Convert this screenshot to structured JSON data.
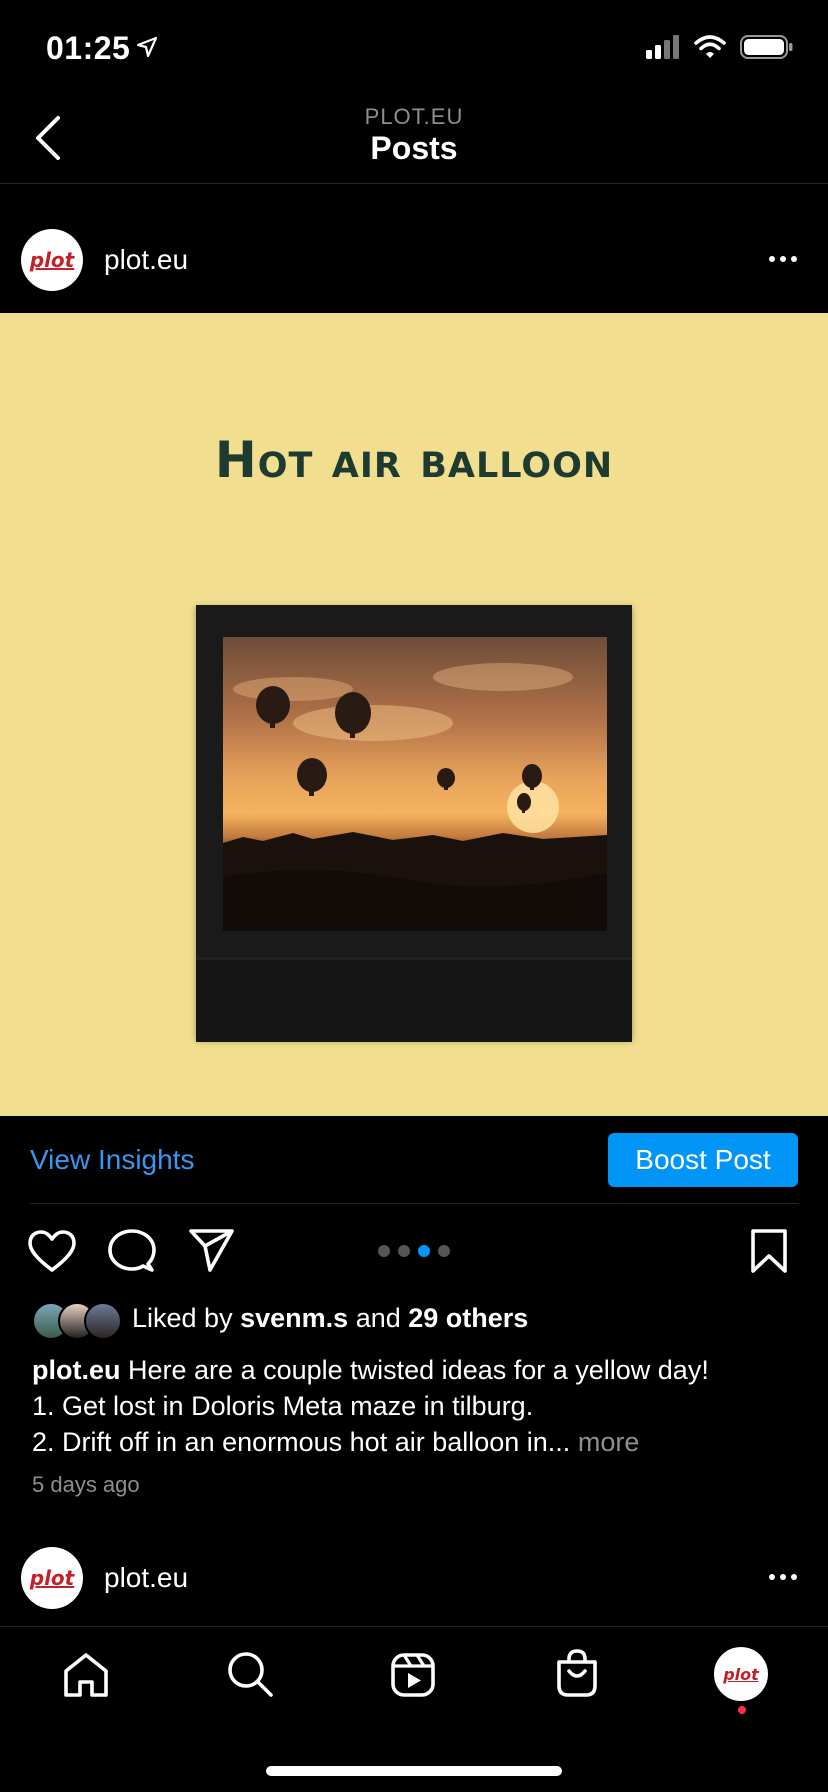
{
  "status_bar": {
    "time": "01:25"
  },
  "nav": {
    "subtitle": "PLOT.EU",
    "title": "Posts"
  },
  "posts": [
    {
      "username": "plot.eu",
      "avatar_text": "plot",
      "image_heading": "Hot air balloon",
      "actions": {
        "insights_label": "View Insights",
        "boost_label": "Boost Post"
      },
      "carousel": {
        "count": 4,
        "active_index": 2
      },
      "likes": {
        "prefix": "Liked by",
        "user": "svenm.s",
        "conjunction": "and",
        "others": "29 others"
      },
      "caption": {
        "username": "plot.eu",
        "line1": "Here are a couple twisted ideas for a yellow day!",
        "line2": "1. Get lost in Doloris Meta maze in tilburg.",
        "line3": "2.  Drift off in an enormous hot air balloon in...",
        "more": "more"
      },
      "time_ago": "5 days ago"
    },
    {
      "username": "plot.eu",
      "avatar_text": "plot"
    }
  ],
  "tabbar": [
    "home-icon",
    "search-icon",
    "reels-icon",
    "shop-icon",
    "profile-avatar"
  ],
  "colors": {
    "accent": "#0095f6",
    "image_bg": "#f1de8e",
    "heading": "#1e3b31",
    "notification": "#ff3040"
  }
}
